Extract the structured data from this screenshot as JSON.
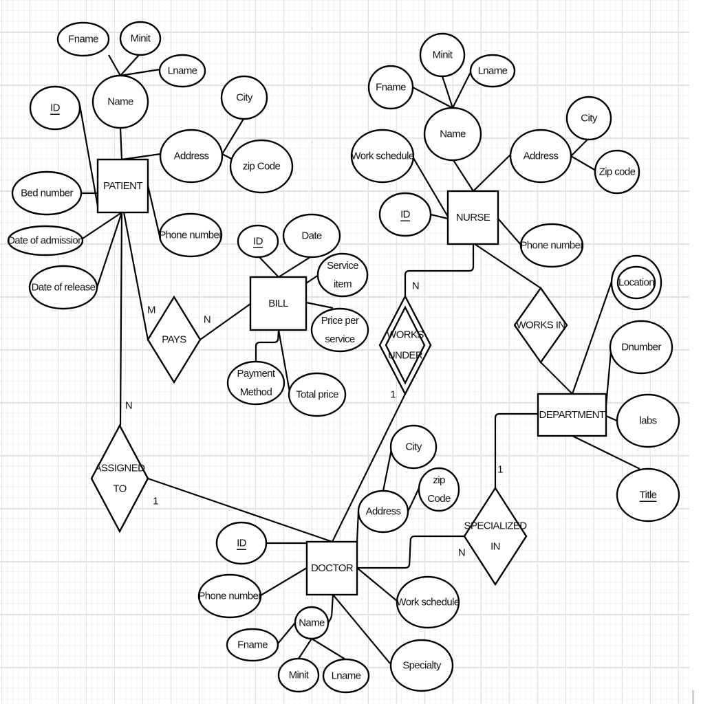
{
  "diagram": {
    "type": "entity-relationship",
    "entities": [
      {
        "id": "patient",
        "label": "PATIENT"
      },
      {
        "id": "bill",
        "label": "BILL"
      },
      {
        "id": "nurse",
        "label": "NURSE"
      },
      {
        "id": "department",
        "label": "DEPARTMENT"
      },
      {
        "id": "doctor",
        "label": "DOCTOR"
      }
    ],
    "relationships": [
      {
        "id": "pays",
        "label": [
          "PAYS"
        ],
        "weak": false
      },
      {
        "id": "works_under",
        "label": [
          "WORKS",
          "UNDER"
        ],
        "weak": true
      },
      {
        "id": "works_in",
        "label": [
          "WORKS IN"
        ],
        "weak": false
      },
      {
        "id": "assigned_to",
        "label": [
          "ASSIGNED",
          "TO"
        ],
        "weak": false
      },
      {
        "id": "specialized_in",
        "label": [
          "SPECIALIZED",
          "IN"
        ],
        "weak": false
      }
    ],
    "attributes": [
      {
        "id": "p_fname",
        "label": [
          "Fname"
        ],
        "key": false,
        "multivalued": false
      },
      {
        "id": "p_minit",
        "label": [
          "Minit"
        ],
        "key": false,
        "multivalued": false
      },
      {
        "id": "p_lname",
        "label": [
          "Lname"
        ],
        "key": false,
        "multivalued": false
      },
      {
        "id": "p_name",
        "label": [
          "Name"
        ],
        "key": false,
        "multivalued": false
      },
      {
        "id": "p_id",
        "label": [
          "ID"
        ],
        "key": true,
        "multivalued": false
      },
      {
        "id": "p_city",
        "label": [
          "City"
        ],
        "key": false,
        "multivalued": false
      },
      {
        "id": "p_address",
        "label": [
          "Address"
        ],
        "key": false,
        "multivalued": false
      },
      {
        "id": "p_zip",
        "label": [
          "zip Code"
        ],
        "key": false,
        "multivalued": false
      },
      {
        "id": "p_bed",
        "label": [
          "Bed number"
        ],
        "key": false,
        "multivalued": false
      },
      {
        "id": "p_phone",
        "label": [
          "Phone number"
        ],
        "key": false,
        "multivalued": false
      },
      {
        "id": "p_admission",
        "label": [
          "Date of admission"
        ],
        "key": false,
        "multivalued": false
      },
      {
        "id": "p_release",
        "label": [
          "Date of release"
        ],
        "key": false,
        "multivalued": false
      },
      {
        "id": "b_id",
        "label": [
          "ID"
        ],
        "key": true,
        "multivalued": false
      },
      {
        "id": "b_date",
        "label": [
          "Date"
        ],
        "key": false,
        "multivalued": false
      },
      {
        "id": "b_service",
        "label": [
          "Service",
          "item"
        ],
        "key": false,
        "multivalued": false
      },
      {
        "id": "b_price",
        "label": [
          "Price per",
          "service"
        ],
        "key": false,
        "multivalued": false
      },
      {
        "id": "b_payment",
        "label": [
          "Payment",
          "Method"
        ],
        "key": false,
        "multivalued": false
      },
      {
        "id": "b_total",
        "label": [
          "Total price"
        ],
        "key": false,
        "multivalued": false
      },
      {
        "id": "n_minit",
        "label": [
          "Minit"
        ],
        "key": false,
        "multivalued": false
      },
      {
        "id": "n_lname",
        "label": [
          "Lname"
        ],
        "key": false,
        "multivalued": false
      },
      {
        "id": "n_fname",
        "label": [
          "Fname"
        ],
        "key": false,
        "multivalued": false
      },
      {
        "id": "n_name",
        "label": [
          "Name"
        ],
        "key": false,
        "multivalued": false
      },
      {
        "id": "n_city",
        "label": [
          "City"
        ],
        "key": false,
        "multivalued": false
      },
      {
        "id": "n_work",
        "label": [
          "Work schedule"
        ],
        "key": false,
        "multivalued": false
      },
      {
        "id": "n_address",
        "label": [
          "Address"
        ],
        "key": false,
        "multivalued": false
      },
      {
        "id": "n_zip",
        "label": [
          "Zip code"
        ],
        "key": false,
        "multivalued": false
      },
      {
        "id": "n_id",
        "label": [
          "ID"
        ],
        "key": true,
        "multivalued": false
      },
      {
        "id": "n_phone",
        "label": [
          "Phone number"
        ],
        "key": false,
        "multivalued": false
      },
      {
        "id": "d_location",
        "label": [
          "Location"
        ],
        "key": false,
        "multivalued": true
      },
      {
        "id": "d_dnumber",
        "label": [
          "Dnumber"
        ],
        "key": false,
        "multivalued": false
      },
      {
        "id": "d_labs",
        "label": [
          "labs"
        ],
        "key": false,
        "multivalued": false
      },
      {
        "id": "d_title",
        "label": [
          "Title"
        ],
        "key": true,
        "multivalued": false
      },
      {
        "id": "dr_city",
        "label": [
          "City"
        ],
        "key": false,
        "multivalued": false
      },
      {
        "id": "dr_zip",
        "label": [
          "zip",
          "Code"
        ],
        "key": false,
        "multivalued": false
      },
      {
        "id": "dr_address",
        "label": [
          "Address"
        ],
        "key": false,
        "multivalued": false
      },
      {
        "id": "dr_id",
        "label": [
          "ID"
        ],
        "key": true,
        "multivalued": false
      },
      {
        "id": "dr_phone",
        "label": [
          "Phone number"
        ],
        "key": false,
        "multivalued": false
      },
      {
        "id": "dr_work",
        "label": [
          "Work schedule"
        ],
        "key": false,
        "multivalued": false
      },
      {
        "id": "dr_name",
        "label": [
          "Name"
        ],
        "key": false,
        "multivalued": false
      },
      {
        "id": "dr_fname",
        "label": [
          "Fname"
        ],
        "key": false,
        "multivalued": false
      },
      {
        "id": "dr_specialty",
        "label": [
          "Specialty"
        ],
        "key": false,
        "multivalued": false
      },
      {
        "id": "dr_minit",
        "label": [
          "Minit"
        ],
        "key": false,
        "multivalued": false
      },
      {
        "id": "dr_lname",
        "label": [
          "Lname"
        ],
        "key": false,
        "multivalued": false
      }
    ],
    "cardinalities": [
      {
        "id": "c_pays_patient",
        "label": "M"
      },
      {
        "id": "c_pays_bill",
        "label": "N"
      },
      {
        "id": "c_works_under_nurse",
        "label": "N"
      },
      {
        "id": "c_works_under_doctor",
        "label": "1"
      },
      {
        "id": "c_assigned_patient",
        "label": "N"
      },
      {
        "id": "c_assigned_doctor",
        "label": "1"
      },
      {
        "id": "c_specialized_department",
        "label": "1"
      },
      {
        "id": "c_specialized_doctor",
        "label": "N"
      }
    ]
  }
}
